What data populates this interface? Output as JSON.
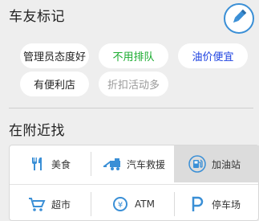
{
  "remarks": {
    "title": "车友标记",
    "tags": [
      {
        "label": "管理员态度好",
        "color": "#222222"
      },
      {
        "label": "不用排队",
        "color": "#1aab2f"
      },
      {
        "label": "油价便宜",
        "color": "#1a3fe0"
      },
      {
        "label": "有便利店",
        "color": "#222222"
      },
      {
        "label": "折扣活动多",
        "color": "#999999"
      }
    ],
    "edit_icon": "pencil-icon"
  },
  "nearby": {
    "title": "在附近找",
    "items": [
      {
        "label": "美食",
        "icon": "fork-knife-icon"
      },
      {
        "label": "汽车救援",
        "icon": "tow-truck-icon"
      },
      {
        "label": "加油站",
        "icon": "gas-pump-icon",
        "selected": true
      },
      {
        "label": "超市",
        "icon": "shopping-cart-icon"
      },
      {
        "label": "ATM",
        "icon": "atm-icon"
      },
      {
        "label": "停车场",
        "icon": "parking-icon"
      }
    ]
  },
  "accent_color": "#3a8fd6"
}
